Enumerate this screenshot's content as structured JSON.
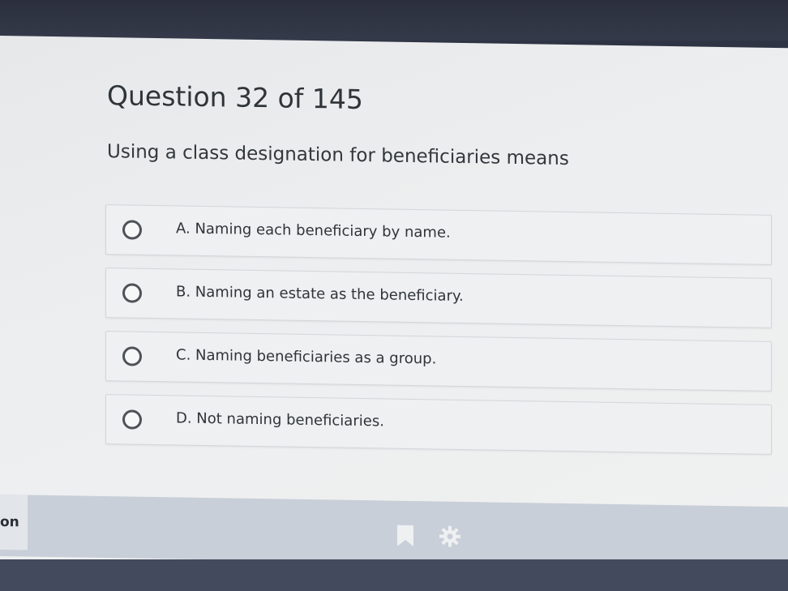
{
  "question": {
    "header": "Question 32 of 145",
    "prompt": "Using a class designation for beneficiaries means"
  },
  "answers": [
    {
      "label": "A. Naming each beneficiary by name."
    },
    {
      "label": "B. Naming an estate as the beneficiary."
    },
    {
      "label": "C. Naming beneficiaries as a group."
    },
    {
      "label": "D. Not naming beneficiaries."
    }
  ],
  "footer": {
    "left_tab_label": "on",
    "icons": [
      "bookmark-icon",
      "gear-icon"
    ]
  },
  "colors": {
    "text": "#2f3438",
    "radio_border": "#4d5257",
    "bottom_bar": "#c9cfd8",
    "icon": "#eef0f2"
  }
}
